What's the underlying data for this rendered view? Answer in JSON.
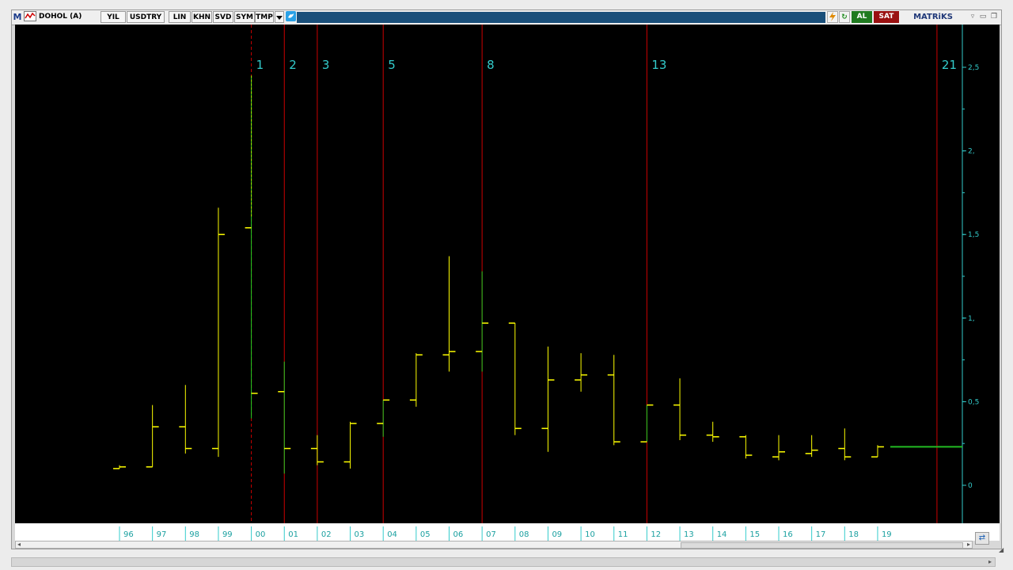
{
  "toolbar": {
    "logo": "M",
    "symbol": "DOHOL (A)",
    "buttons": [
      "YIL",
      "USDTRY",
      "LIN",
      "KHN",
      "SVD",
      "SYM",
      "TMP"
    ],
    "dropdown_icon": "triangle-down",
    "twitter_icon": "bird",
    "buy_label": "AL",
    "sell_label": "SAT",
    "brand": "MATRiKS",
    "colors": {
      "title_bg": "#1a4f7a",
      "buy": "#1f7a1f",
      "sell": "#9a1010"
    }
  },
  "chart_data": {
    "type": "ohlc",
    "x_labels": [
      "96",
      "97",
      "98",
      "99",
      "00",
      "01",
      "02",
      "03",
      "04",
      "05",
      "06",
      "07",
      "08",
      "09",
      "10",
      "11",
      "12",
      "13",
      "14",
      "15",
      "16",
      "17",
      "18",
      "19"
    ],
    "y_tick_labels": [
      "0",
      "0,5",
      "1,",
      "1,5",
      "2,",
      "2,5"
    ],
    "y_range": [
      0,
      2.5
    ],
    "fibonacci_labels": [
      "1",
      "2",
      "3",
      "5",
      "8",
      "13",
      "21"
    ],
    "fibonacci_at_index": [
      4,
      5,
      6,
      8,
      11,
      16,
      24
    ],
    "ohlc": [
      {
        "o": 0.1,
        "h": 0.12,
        "l": 0.1,
        "c": 0.11,
        "dir": "up"
      },
      {
        "o": 0.11,
        "h": 0.48,
        "l": 0.11,
        "c": 0.35,
        "dir": "up"
      },
      {
        "o": 0.35,
        "h": 0.6,
        "l": 0.19,
        "c": 0.22,
        "dir": "down"
      },
      {
        "o": 0.22,
        "h": 1.66,
        "l": 0.17,
        "c": 1.5,
        "dir": "up"
      },
      {
        "o": 1.54,
        "h": 2.45,
        "l": 0.4,
        "c": 0.55,
        "dir": "down"
      },
      {
        "o": 0.56,
        "h": 0.74,
        "l": 0.07,
        "c": 0.22,
        "dir": "down"
      },
      {
        "o": 0.22,
        "h": 0.3,
        "l": 0.12,
        "c": 0.14,
        "dir": "down"
      },
      {
        "o": 0.14,
        "h": 0.38,
        "l": 0.1,
        "c": 0.37,
        "dir": "up"
      },
      {
        "o": 0.37,
        "h": 0.51,
        "l": 0.29,
        "c": 0.51,
        "dir": "up"
      },
      {
        "o": 0.51,
        "h": 0.79,
        "l": 0.47,
        "c": 0.78,
        "dir": "up"
      },
      {
        "o": 0.78,
        "h": 1.37,
        "l": 0.68,
        "c": 0.8,
        "dir": "up"
      },
      {
        "o": 0.8,
        "h": 1.28,
        "l": 0.68,
        "c": 0.97,
        "dir": "up"
      },
      {
        "o": 0.97,
        "h": 0.97,
        "l": 0.3,
        "c": 0.34,
        "dir": "down"
      },
      {
        "o": 0.34,
        "h": 0.83,
        "l": 0.2,
        "c": 0.63,
        "dir": "up"
      },
      {
        "o": 0.63,
        "h": 0.79,
        "l": 0.56,
        "c": 0.66,
        "dir": "up"
      },
      {
        "o": 0.66,
        "h": 0.78,
        "l": 0.24,
        "c": 0.26,
        "dir": "down"
      },
      {
        "o": 0.26,
        "h": 0.48,
        "l": 0.26,
        "c": 0.48,
        "dir": "up"
      },
      {
        "o": 0.48,
        "h": 0.64,
        "l": 0.27,
        "c": 0.3,
        "dir": "down"
      },
      {
        "o": 0.3,
        "h": 0.38,
        "l": 0.26,
        "c": 0.29,
        "dir": "down"
      },
      {
        "o": 0.29,
        "h": 0.3,
        "l": 0.16,
        "c": 0.18,
        "dir": "down"
      },
      {
        "o": 0.17,
        "h": 0.3,
        "l": 0.15,
        "c": 0.2,
        "dir": "up"
      },
      {
        "o": 0.19,
        "h": 0.3,
        "l": 0.17,
        "c": 0.21,
        "dir": "up"
      },
      {
        "o": 0.22,
        "h": 0.34,
        "l": 0.15,
        "c": 0.17,
        "dir": "down"
      },
      {
        "o": 0.17,
        "h": 0.24,
        "l": 0.17,
        "c": 0.23,
        "dir": "up"
      }
    ],
    "last_price": 0.23,
    "colors": {
      "background": "#000000",
      "bar_up": "#ffff00",
      "bar_down": "#e6e600",
      "bar_strong": "#22cc22",
      "fib_line": "#cc0000",
      "fib_label": "#33cccc",
      "axis": "#33cccc",
      "last_price_line": "#22bb22"
    }
  }
}
